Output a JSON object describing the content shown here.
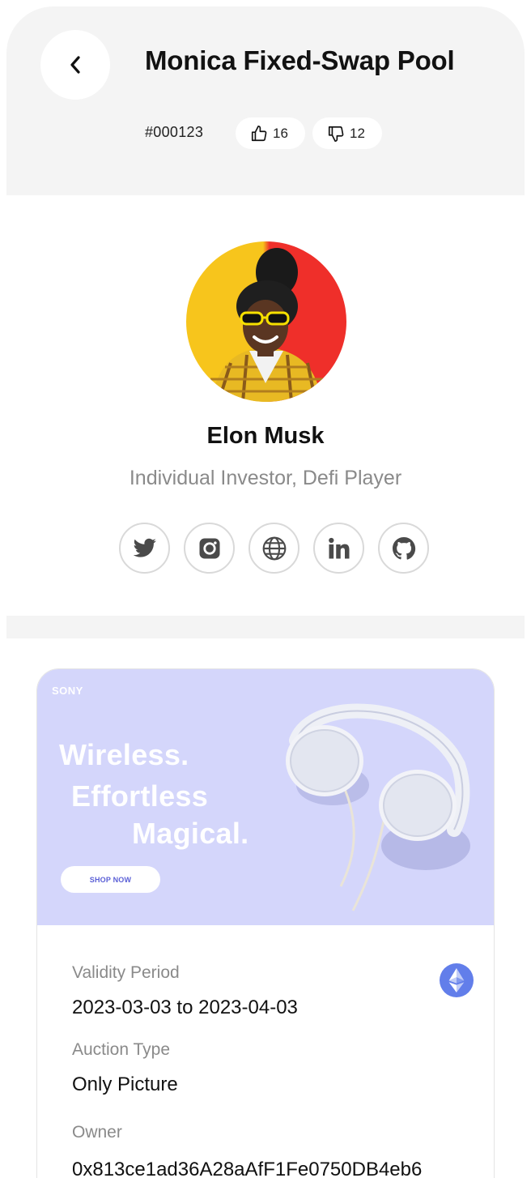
{
  "header": {
    "title": "Monica Fixed-Swap Pool",
    "pool_id": "#000123",
    "likes": "16",
    "dislikes": "12"
  },
  "profile": {
    "name": "Elon Musk",
    "role": "Individual Investor, Defi Player",
    "socials": [
      "twitter-icon",
      "instagram-icon",
      "globe-icon",
      "linkedin-icon",
      "github-icon"
    ]
  },
  "banner": {
    "brand": "SONY",
    "line1": "Wireless.",
    "line2": "Effortless",
    "line3": "Magical.",
    "cta": "SHOP NOW"
  },
  "details": {
    "validity_label": "Validity Period",
    "validity_value": "2023-03-03 to 2023-04-03",
    "auction_label": "Auction Type",
    "auction_value": "Only Picture",
    "owner_label": "Owner",
    "owner_value": "0x813ce1ad36A28aAfF1Fe0750DB4eb6"
  },
  "colors": {
    "header_bg": "#f4f4f4",
    "banner_bg": "#d4d6fb",
    "eth": "#627eea",
    "muted_text": "#8a8a8a"
  }
}
